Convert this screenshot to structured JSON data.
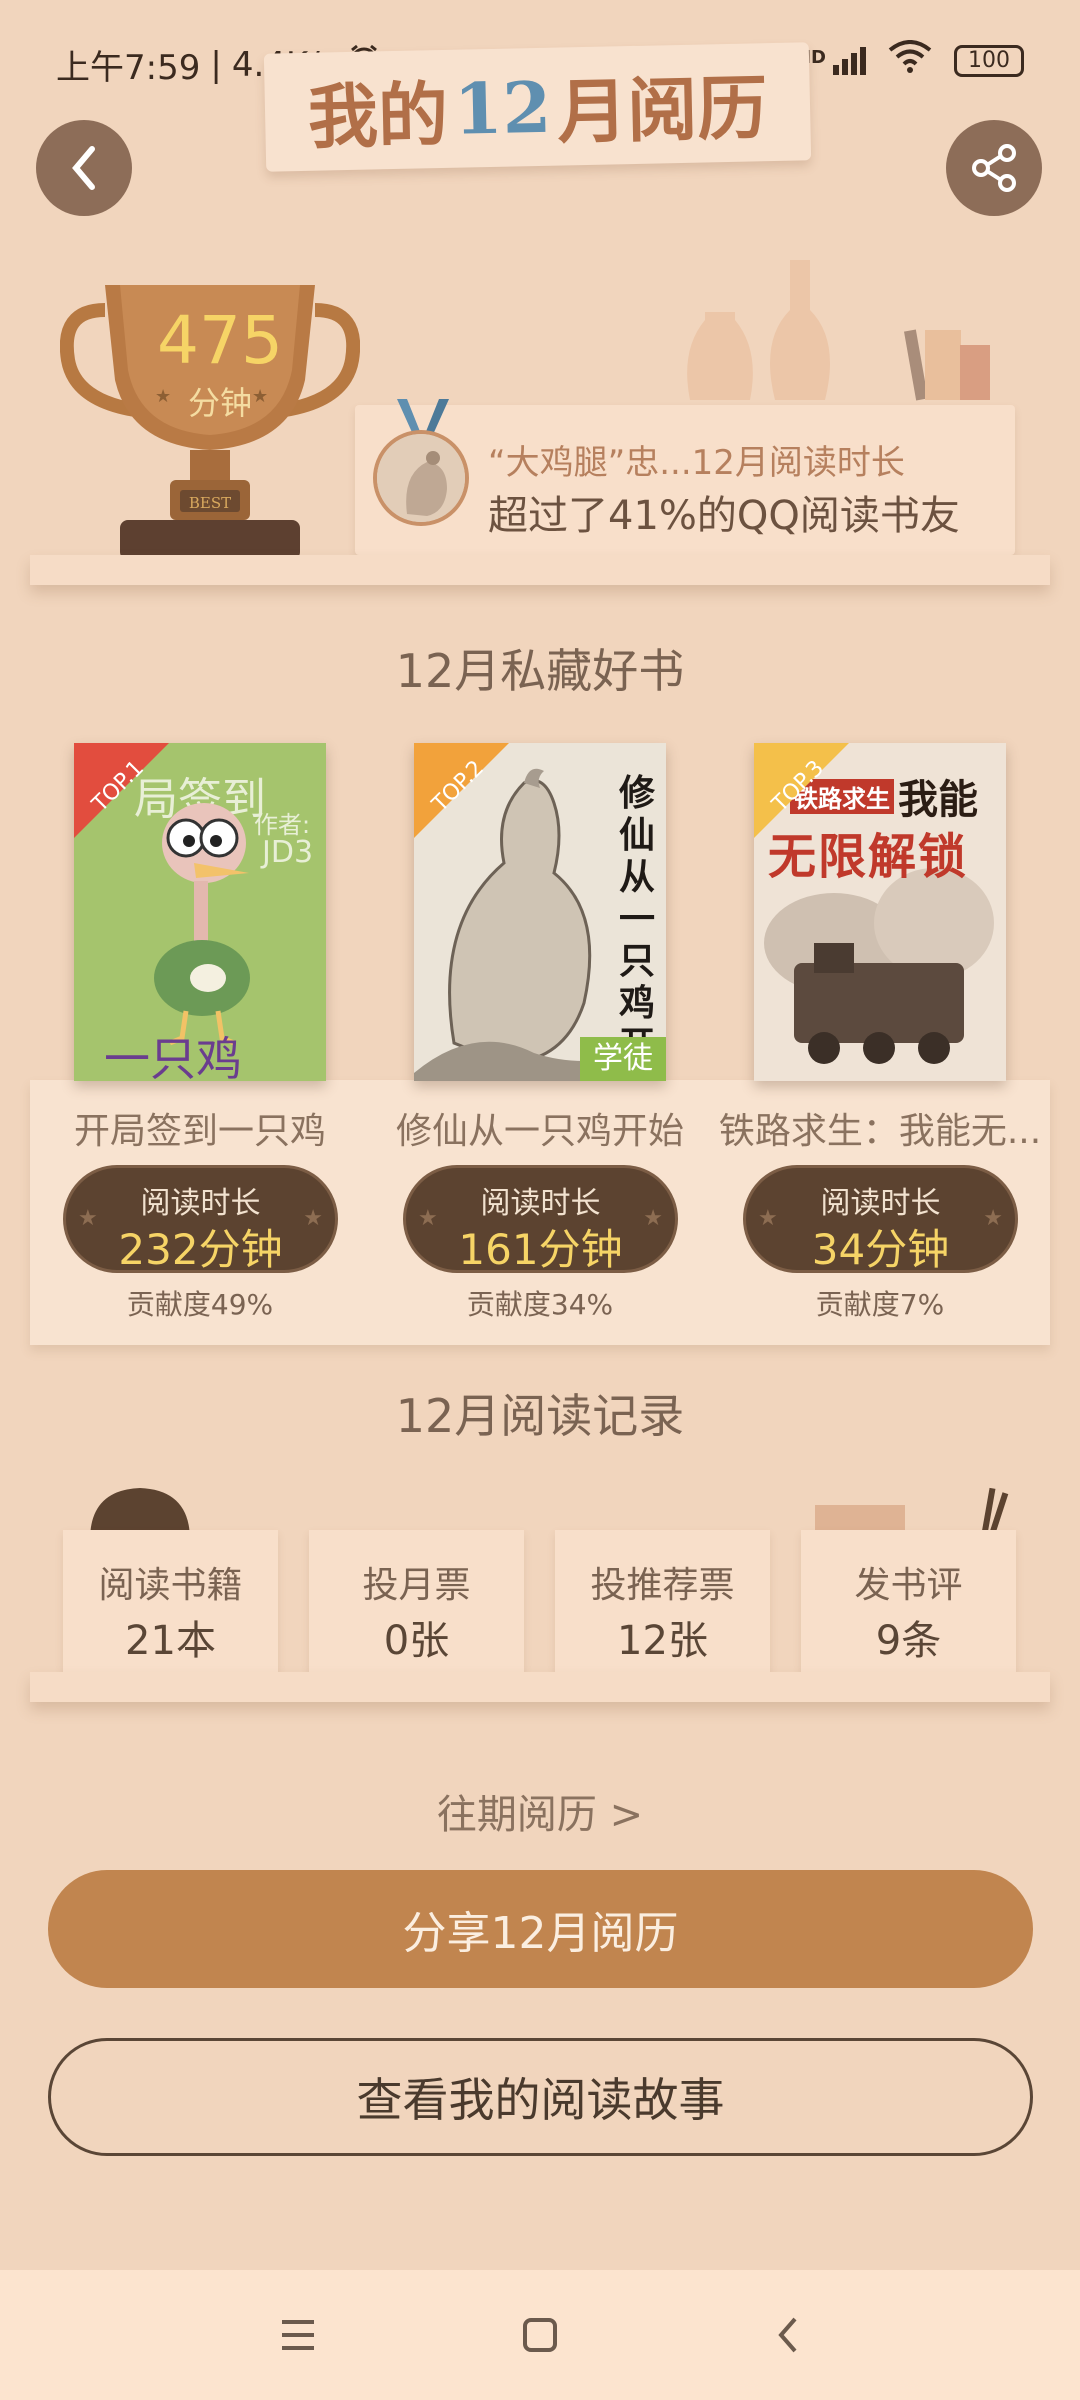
{
  "status_bar": {
    "time": "上午7:59",
    "speed": "4.4K/s",
    "network": "HD",
    "battery": "100"
  },
  "header": {
    "title_prefix": "我的",
    "title_month": "12",
    "title_suffix": "月阅历"
  },
  "trophy": {
    "value": "475",
    "unit": "分钟",
    "badge": "BEST"
  },
  "rank": {
    "line1": "“大鸡腿”忠...12月阅读时长",
    "line2": "超过了41%的QQ阅读书友"
  },
  "favorites": {
    "title": "12月私藏好书",
    "time_label": "阅读时长",
    "books": [
      {
        "rank": "TOP.1",
        "title": "开局签到一只鸡",
        "duration": "232分钟",
        "contribution": "贡献度49%",
        "cover_title": "局签到",
        "cover_author": "作者:",
        "cover_author2": "JD3",
        "cover_bottom": "一只鸡"
      },
      {
        "rank": "TOP.2",
        "title": "修仙从一只鸡开始",
        "duration": "161分钟",
        "contribution": "贡献度34%",
        "cover_title": "修仙从一只鸡开始",
        "cover_badge": "学徒"
      },
      {
        "rank": "TOP.3",
        "title": "铁路求生：我能无...",
        "duration": "34分钟",
        "contribution": "贡献度7%",
        "cover_title_top": "铁路求生",
        "cover_title_main": "我能",
        "cover_title_sub": "无限解锁"
      }
    ]
  },
  "records": {
    "title": "12月阅读记录",
    "items": [
      {
        "label": "阅读书籍",
        "value": "21本"
      },
      {
        "label": "投月票",
        "value": "0张"
      },
      {
        "label": "投推荐票",
        "value": "12张"
      },
      {
        "label": "发书评",
        "value": "9条"
      }
    ]
  },
  "history_link": "往期阅历 >",
  "share_button": "分享12月阅历",
  "story_button": "查看我的阅读故事",
  "colors": {
    "background": "#f1d5bd",
    "accent": "#c1854f",
    "badge_dark": "#5c4330",
    "gold": "#f6d466"
  }
}
